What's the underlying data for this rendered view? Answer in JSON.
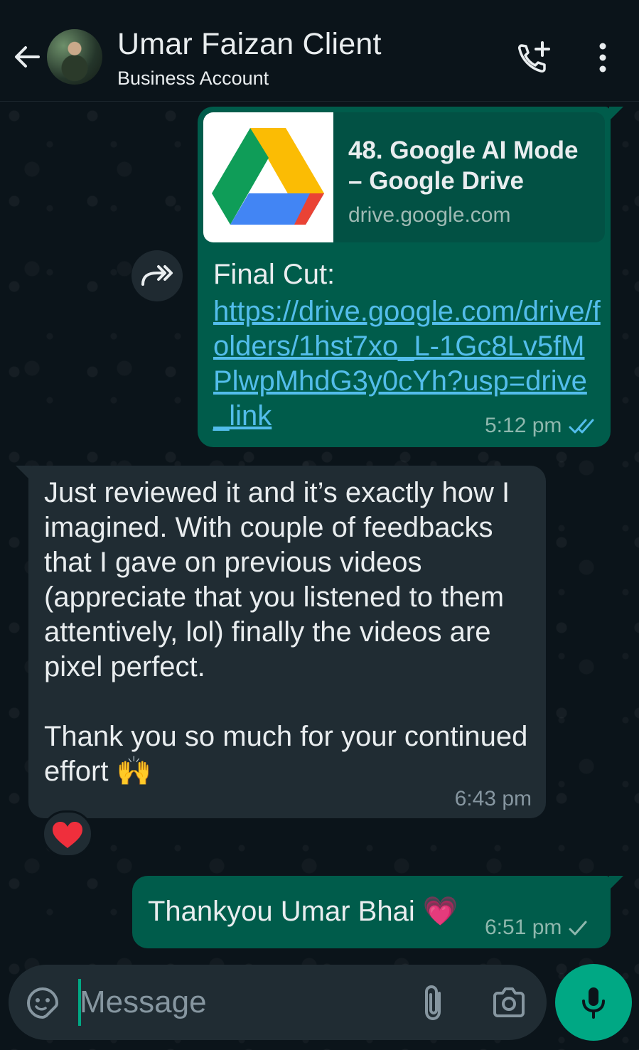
{
  "header": {
    "contact_name": "Umar Faizan Client",
    "subtitle": "Business Account"
  },
  "messages": [
    {
      "direction": "out",
      "preview": {
        "title": "48. Google AI Mode – Google Drive",
        "domain": "drive.google.com"
      },
      "caption": "Final Cut:",
      "url": "https://drive.google.com/drive/folders/1hst7xo_L-1Gc8Lv5fMPlwpMhdG3y0cYh?usp=drive_link",
      "time": "5:12 pm",
      "status": "read"
    },
    {
      "direction": "in",
      "paragraph1": "Just reviewed it and it’s exactly how I imagined. With couple of feedbacks that I gave on previous videos (appreciate that you listened to them attentively, lol) finally the videos are pixel perfect.",
      "paragraph2": "Thank you so much for your continued effort 🙌",
      "time": "6:43 pm",
      "reaction": "❤️"
    },
    {
      "direction": "out",
      "text": "Thankyou Umar Bhai 💗",
      "time": "6:51 pm",
      "status": "sent"
    }
  ],
  "composer": {
    "placeholder": "Message"
  },
  "colors": {
    "background": "#0b141a",
    "outgoing_bubble": "#005c4b",
    "incoming_bubble": "#202c33",
    "accent": "#00a884",
    "link": "#53bdeb",
    "read_ticks": "#53bdeb"
  },
  "icons": [
    "back-arrow-icon",
    "add-call-icon",
    "more-vert-icon",
    "forward-icon",
    "double-check-icon",
    "single-check-icon",
    "emoji-icon",
    "attach-icon",
    "camera-icon",
    "mic-icon",
    "google-drive-logo"
  ]
}
